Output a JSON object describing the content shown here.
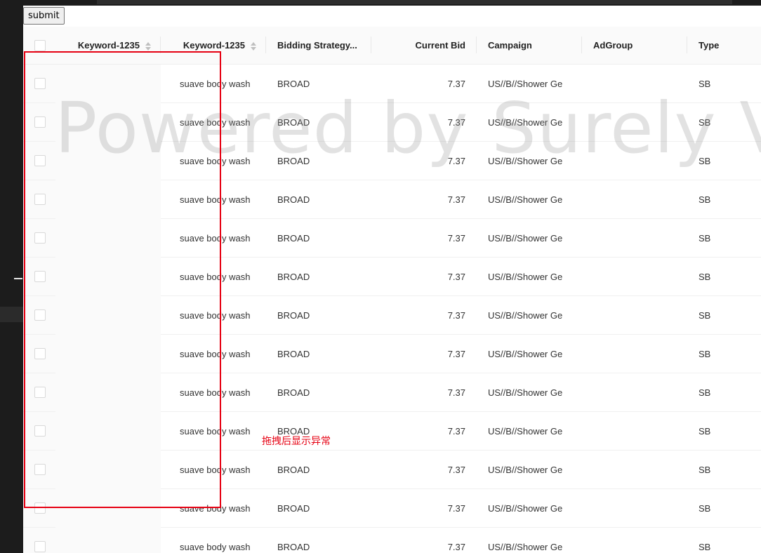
{
  "toolbar": {
    "submit_label": "submit"
  },
  "table": {
    "columns": [
      {
        "key": "keyword1",
        "label": "Keyword-1235",
        "sortable": true
      },
      {
        "key": "keyword2",
        "label": "Keyword-1235",
        "sortable": true
      },
      {
        "key": "bidding",
        "label": "Bidding Strategy...",
        "sortable": false
      },
      {
        "key": "bid",
        "label": "Current Bid",
        "sortable": false
      },
      {
        "key": "campaign",
        "label": "Campaign",
        "sortable": false
      },
      {
        "key": "adgroup",
        "label": "AdGroup",
        "sortable": false
      },
      {
        "key": "type",
        "label": "Type",
        "sortable": false
      }
    ],
    "rows": [
      {
        "keyword1": "",
        "keyword2": "suave body wash",
        "bidding": "BROAD",
        "bid": "7.37",
        "campaign": "US//B//Shower Ge",
        "adgroup": "",
        "type": "SB"
      },
      {
        "keyword1": "",
        "keyword2": "suave body wash",
        "bidding": "BROAD",
        "bid": "7.37",
        "campaign": "US//B//Shower Ge",
        "adgroup": "",
        "type": "SB"
      },
      {
        "keyword1": "",
        "keyword2": "suave body wash",
        "bidding": "BROAD",
        "bid": "7.37",
        "campaign": "US//B//Shower Ge",
        "adgroup": "",
        "type": "SB"
      },
      {
        "keyword1": "",
        "keyword2": "suave body wash",
        "bidding": "BROAD",
        "bid": "7.37",
        "campaign": "US//B//Shower Ge",
        "adgroup": "",
        "type": "SB"
      },
      {
        "keyword1": "",
        "keyword2": "suave body wash",
        "bidding": "BROAD",
        "bid": "7.37",
        "campaign": "US//B//Shower Ge",
        "adgroup": "",
        "type": "SB"
      },
      {
        "keyword1": "",
        "keyword2": "suave body wash",
        "bidding": "BROAD",
        "bid": "7.37",
        "campaign": "US//B//Shower Ge",
        "adgroup": "",
        "type": "SB"
      },
      {
        "keyword1": "",
        "keyword2": "suave body wash",
        "bidding": "BROAD",
        "bid": "7.37",
        "campaign": "US//B//Shower Ge",
        "adgroup": "",
        "type": "SB"
      },
      {
        "keyword1": "",
        "keyword2": "suave body wash",
        "bidding": "BROAD",
        "bid": "7.37",
        "campaign": "US//B//Shower Ge",
        "adgroup": "",
        "type": "SB"
      },
      {
        "keyword1": "",
        "keyword2": "suave body wash",
        "bidding": "BROAD",
        "bid": "7.37",
        "campaign": "US//B//Shower Ge",
        "adgroup": "",
        "type": "SB"
      },
      {
        "keyword1": "",
        "keyword2": "suave body wash",
        "bidding": "BROAD",
        "bid": "7.37",
        "campaign": "US//B//Shower Ge",
        "adgroup": "",
        "type": "SB"
      },
      {
        "keyword1": "",
        "keyword2": "suave body wash",
        "bidding": "BROAD",
        "bid": "7.37",
        "campaign": "US//B//Shower Ge",
        "adgroup": "",
        "type": "SB"
      },
      {
        "keyword1": "",
        "keyword2": "suave body wash",
        "bidding": "BROAD",
        "bid": "7.37",
        "campaign": "US//B//Shower Ge",
        "adgroup": "",
        "type": "SB"
      },
      {
        "keyword1": "",
        "keyword2": "suave body wash",
        "bidding": "BROAD",
        "bid": "7.37",
        "campaign": "US//B//Shower Ge",
        "adgroup": "",
        "type": "SB"
      }
    ]
  },
  "watermark": "Powered by Surely Vue",
  "annotation": {
    "text": "拖拽后显示异常",
    "color": "#e60012"
  },
  "icons": {
    "sort": "sort-caret-icon",
    "checkbox": "checkbox-icon"
  }
}
